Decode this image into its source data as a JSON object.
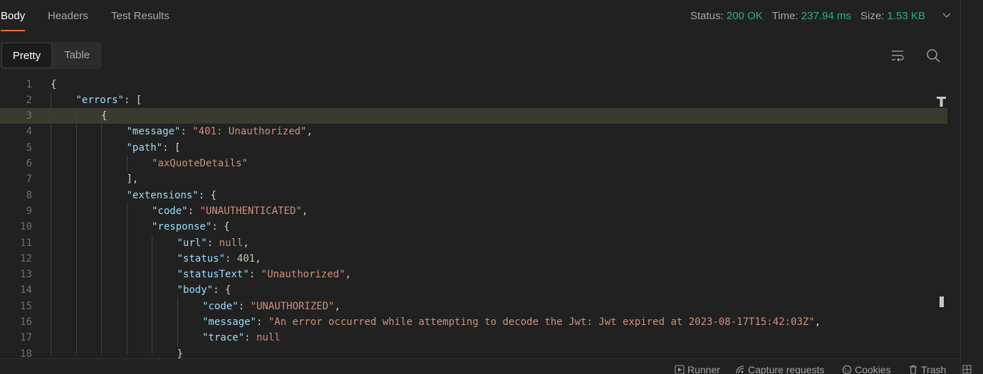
{
  "tabs": {
    "body": "Body",
    "headers": "Headers",
    "test_results": "Test Results"
  },
  "status": {
    "status_label": "Status:",
    "status_value": "200 OK",
    "time_label": "Time:",
    "time_value": "237.94 ms",
    "size_label": "Size:",
    "size_value": "1.53 KB"
  },
  "view_toggle": {
    "pretty": "Pretty",
    "table": "Table"
  },
  "editor": {
    "line_numbers": [
      "1",
      "2",
      "3",
      "4",
      "5",
      "6",
      "7",
      "8",
      "9",
      "10",
      "11",
      "12",
      "13",
      "14",
      "15",
      "16",
      "17",
      "18"
    ],
    "lines": [
      [
        [
          "p",
          "{"
        ]
      ],
      [
        [
          "k",
          "\"errors\""
        ],
        [
          "p",
          ": ["
        ]
      ],
      [
        [
          "p",
          "{"
        ]
      ],
      [
        [
          "k",
          "\"message\""
        ],
        [
          "p",
          ": "
        ],
        [
          "s",
          "\"401: Unauthorized\""
        ],
        [
          "p",
          ","
        ]
      ],
      [
        [
          "k",
          "\"path\""
        ],
        [
          "p",
          ": ["
        ]
      ],
      [
        [
          "s",
          "\"axQuoteDetails\""
        ]
      ],
      [
        [
          "p",
          "],"
        ]
      ],
      [
        [
          "k",
          "\"extensions\""
        ],
        [
          "p",
          ": {"
        ]
      ],
      [
        [
          "k",
          "\"code\""
        ],
        [
          "p",
          ": "
        ],
        [
          "s",
          "\"UNAUTHENTICATED\""
        ],
        [
          "p",
          ","
        ]
      ],
      [
        [
          "k",
          "\"response\""
        ],
        [
          "p",
          ": {"
        ]
      ],
      [
        [
          "k",
          "\"url\""
        ],
        [
          "p",
          ": "
        ],
        [
          "nul",
          "null"
        ],
        [
          "p",
          ","
        ]
      ],
      [
        [
          "k",
          "\"status\""
        ],
        [
          "p",
          ": "
        ],
        [
          "n",
          "401"
        ],
        [
          "p",
          ","
        ]
      ],
      [
        [
          "k",
          "\"statusText\""
        ],
        [
          "p",
          ": "
        ],
        [
          "s",
          "\"Unauthorized\""
        ],
        [
          "p",
          ","
        ]
      ],
      [
        [
          "k",
          "\"body\""
        ],
        [
          "p",
          ": {"
        ]
      ],
      [
        [
          "k",
          "\"code\""
        ],
        [
          "p",
          ": "
        ],
        [
          "s",
          "\"UNAUTHORIZED\""
        ],
        [
          "p",
          ","
        ]
      ],
      [
        [
          "k",
          "\"message\""
        ],
        [
          "p",
          ": "
        ],
        [
          "s",
          "\"An error occurred while attempting to decode the Jwt: Jwt expired at 2023-08-17T15:42:03Z\""
        ],
        [
          "p",
          ","
        ]
      ],
      [
        [
          "k",
          "\"trace\""
        ],
        [
          "p",
          ": "
        ],
        [
          "nul",
          "null"
        ]
      ],
      [
        [
          "p",
          "}"
        ]
      ]
    ],
    "highlighted_line": 3
  },
  "footer": {
    "runner": "Runner",
    "capture": "Capture requests",
    "cookies": "Cookies",
    "trash": "Trash"
  },
  "colors": {
    "accent": "#ff6c37",
    "status_ok": "#26b47f",
    "json_key": "#9cdcfe",
    "json_string": "#ce9178",
    "json_number": "#b5cea8"
  }
}
